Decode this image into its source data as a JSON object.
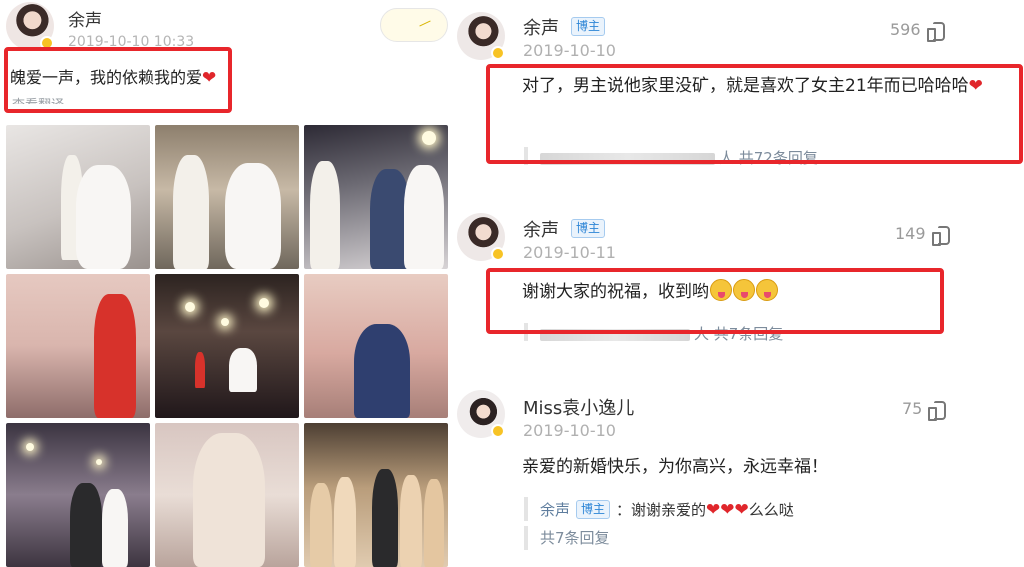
{
  "left_post": {
    "author": "余声",
    "time": "2019-10-10 10:33",
    "text": "魄爱一声，我的依赖我的爱",
    "heart": "❤",
    "translate_label": "查看翻译"
  },
  "comments": [
    {
      "author": "余声",
      "badge": "博主",
      "date": "2019-10-10",
      "likes": "596",
      "text": "对了，男主说他家里没矿，就是喜欢了女主21年而已哈哈哈",
      "heart": "❤",
      "reply_summary": "人 共72条回复"
    },
    {
      "author": "余声",
      "badge": "博主",
      "date": "2019-10-11",
      "likes": "149",
      "text": "谢谢大家的祝福，收到哟",
      "reply_summary": "人 共7条回复"
    },
    {
      "author": "Miss袁小逸儿",
      "date": "2019-10-10",
      "likes": "75",
      "text": "亲爱的新婚快乐，为你高兴，永远幸福！",
      "reply_name": "余声",
      "reply_badge": "博主",
      "reply_text": "：谢谢亲爱的",
      "reply_hearts": "❤❤❤",
      "reply_tail": "么么哒",
      "reply_summary": "共7条回复"
    }
  ],
  "colors": {
    "highlight_box": "#e8262b",
    "badge_blue": "#2d85d6",
    "heart_red": "#e0262b"
  }
}
